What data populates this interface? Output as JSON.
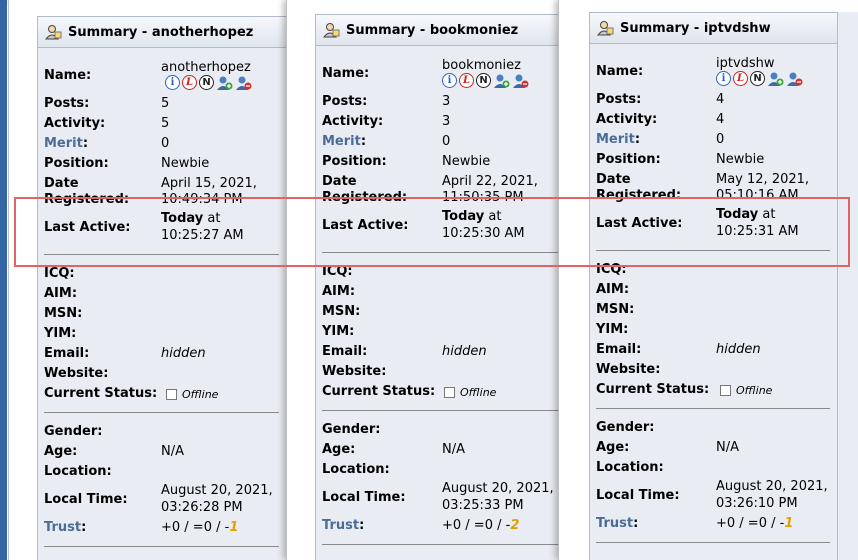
{
  "labels": {
    "name": "Name:",
    "posts": "Posts:",
    "activity": "Activity:",
    "merit": "Merit",
    "merit_colon": ":",
    "position": "Position:",
    "date_registered_1": "Date",
    "date_registered_2": "Registered:",
    "last_active": "Last Active:",
    "icq": "ICQ:",
    "aim": "AIM:",
    "msn": "MSN:",
    "yim": "YIM:",
    "email": "Email:",
    "website": "Website:",
    "current_status": "Current Status:",
    "gender": "Gender:",
    "age": "Age:",
    "location": "Location:",
    "local_time": "Local Time:",
    "trust": "Trust",
    "trust_colon": ":"
  },
  "profiles": [
    {
      "title": "Summary - anotherhopez",
      "name": "anotherhopez",
      "posts": "5",
      "activity": "5",
      "merit": "0",
      "position": "Newbie",
      "registered_1": "April 15, 2021,",
      "registered_2": "10:49:34 PM",
      "last_active_day": "Today",
      "last_active_at": " at",
      "last_active_time": "10:25:27 AM",
      "email": "hidden",
      "status": "Offline",
      "age": "N/A",
      "local_time_1": "August 20, 2021,",
      "local_time_2": "03:26:28 PM",
      "trust_prefix": "+0 / =0 / -",
      "trust_last": "1"
    },
    {
      "title": "Summary - bookmoniez",
      "name": "bookmoniez",
      "posts": "3",
      "activity": "3",
      "merit": "0",
      "position": "Newbie",
      "registered_1": "April 22, 2021,",
      "registered_2": "11:50:35 PM",
      "last_active_day": "Today",
      "last_active_at": " at",
      "last_active_time": "10:25:30 AM",
      "email": "hidden",
      "status": "Offline",
      "age": "N/A",
      "local_time_1": "August 20, 2021,",
      "local_time_2": "03:25:33 PM",
      "trust_prefix": "+0 / =0 / -",
      "trust_last": "2"
    },
    {
      "title": "Summary - iptvdshw",
      "name": "iptvdshw",
      "posts": "4",
      "activity": "4",
      "merit": "0",
      "position": "Newbie",
      "registered_1": "May 12, 2021,",
      "registered_2": "05:10:16 AM",
      "last_active_day": "Today",
      "last_active_at": " at",
      "last_active_time": "10:25:31 AM",
      "email": "hidden",
      "status": "Offline",
      "age": "N/A",
      "local_time_1": "August 20, 2021,",
      "local_time_2": "03:26:10 PM",
      "trust_prefix": "+0 / =0 / -",
      "trust_last": "1"
    }
  ],
  "icons": [
    "user-icon",
    "info-icon",
    "ignore-icon",
    "notify-icon",
    "add-buddy-icon",
    "remove-buddy-icon",
    "checkbox-icon"
  ],
  "colors": {
    "highlight": "#e06464",
    "link_label": "#4a6c96",
    "panel_bg": "#e9edf3",
    "trust_negative": "#e0a000"
  }
}
